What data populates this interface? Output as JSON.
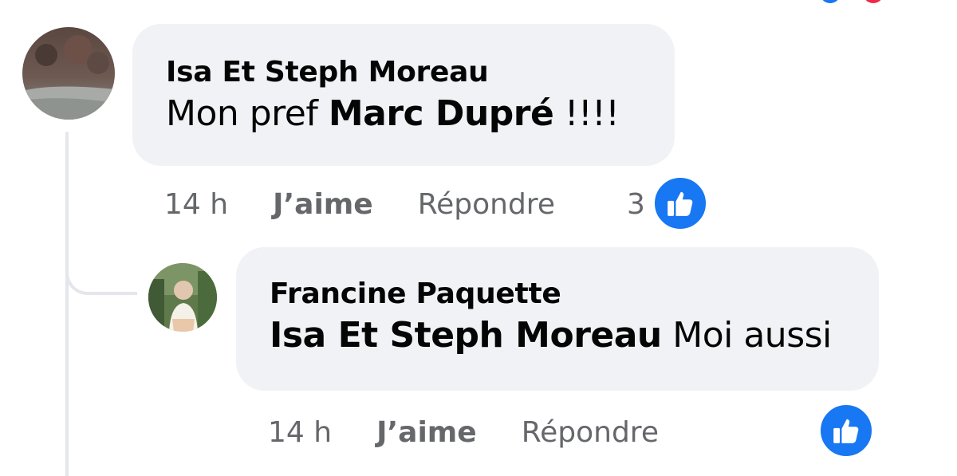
{
  "comments": [
    {
      "author": "Isa Et Steph Moreau",
      "text_prefix": "Mon pref ",
      "mention": "Marc Dupré",
      "text_suffix": " !!!!",
      "time": "14 h",
      "like_label": "J’aime",
      "reply_label": "Répondre",
      "reaction_count": "3",
      "reaction_icon": "thumbs-up-icon"
    },
    {
      "author": "Francine Paquette",
      "mention": "Isa Et Steph Moreau",
      "text_suffix": " Moi aussi",
      "time": "14 h",
      "like_label": "J’aime",
      "reply_label": "Répondre",
      "reaction_icon": "thumbs-up-icon"
    }
  ],
  "colors": {
    "bubble": "#f0f2f5",
    "secondary_text": "#65676b",
    "like_blue": "#1877f2",
    "thread_line": "#e4e6eb"
  }
}
